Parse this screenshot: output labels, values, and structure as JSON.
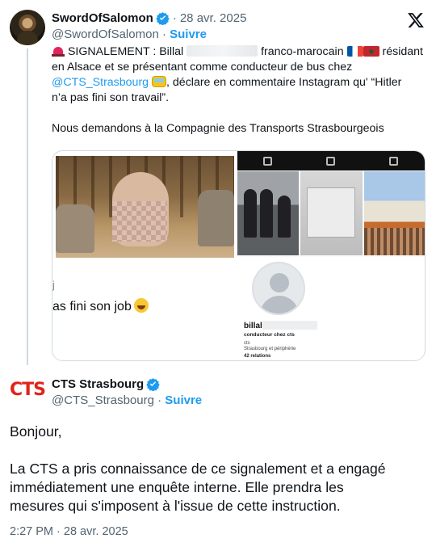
{
  "quoted_tweet": {
    "author_name": "SwordOfSalomon",
    "date": "28 avr. 2025",
    "handle": "@SwordOfSalomon",
    "follow_label": "Suivre",
    "text": {
      "l1_a": " SIGNALEMENT : Billal",
      "l1_b": "franco-marocain",
      "l1_c": "résidant",
      "l2": "en Alsace et se présentant comme conducteur de bus chez",
      "l3_mention": "@CTS_Strasbourg",
      "l3_rest": ", déclare en commentaire Instagram qu' “Hitler",
      "l4": "n’a pas fini son travail”.",
      "l5": "Nous demandons à la Compagnie des Transports Strasbourgeois"
    },
    "media": {
      "left_prefix": "j",
      "left_caption": "as fini son job",
      "ig_name": "billal",
      "ig_role": "conducteur chez cts",
      "ig_org": "cts",
      "ig_location": "Strasbourg et périphérie",
      "ig_relations": "42 relations"
    }
  },
  "main_tweet": {
    "logo_text": "CTS",
    "author_name": "CTS Strasbourg",
    "handle": "@CTS_Strasbourg",
    "follow_label": "Suivre",
    "body": {
      "greeting": "Bonjour,",
      "l1": "La CTS a pris connaissance de ce signalement et a engagé",
      "l2": "immédiatement une enquête interne. Elle prendra les",
      "l3": "mesures qui s'imposent à l'issue de cette instruction."
    },
    "timestamp": "2:27 PM · 28 avr. 2025"
  },
  "separator": "·",
  "colors": {
    "accent": "#1d9bf0",
    "muted": "#536471",
    "cts_red": "#e2231a"
  },
  "icons": [
    "verified-badge-icon",
    "x-logo-icon",
    "siren-emoji-icon",
    "flag-france-icon",
    "flag-morocco-icon",
    "bus-emoji-icon",
    "laughing-emoji-icon"
  ]
}
